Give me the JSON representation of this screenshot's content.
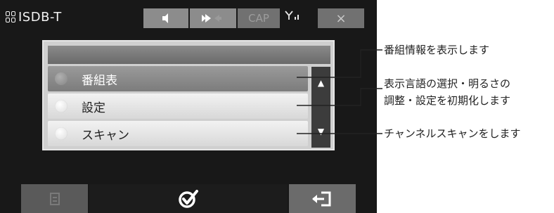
{
  "status_bar": {
    "app_title": "ISDB-T",
    "app_icon": "grid-icon",
    "cap_label": "CAP",
    "close_label": "×",
    "icons": [
      "mute-speaker-icon",
      "volume-icon",
      "signal-antenna-icon",
      "close-icon"
    ]
  },
  "menu": {
    "items": [
      {
        "label": "番組表",
        "selected": true
      },
      {
        "label": "設定",
        "selected": false
      },
      {
        "label": "スキャン",
        "selected": false
      }
    ],
    "scroll_up": "▲",
    "scroll_down": "▼"
  },
  "bottom_bar": {
    "icons": [
      "list-icon",
      "checkmark-icon",
      "back-icon"
    ]
  },
  "callouts": {
    "c1": "番組情報を表示します",
    "c2_line1": "表示言語の選択・明るさの",
    "c2_line2": "調整・設定を初期化します",
    "c3": "チャンネルスキャンをします"
  },
  "colors": {
    "screen_bg": "#181818",
    "button_gray": "#8c8c8c",
    "selected_row": "#8a8a8a",
    "normal_row": "#e6e6e6",
    "leader_line": "#222222"
  }
}
